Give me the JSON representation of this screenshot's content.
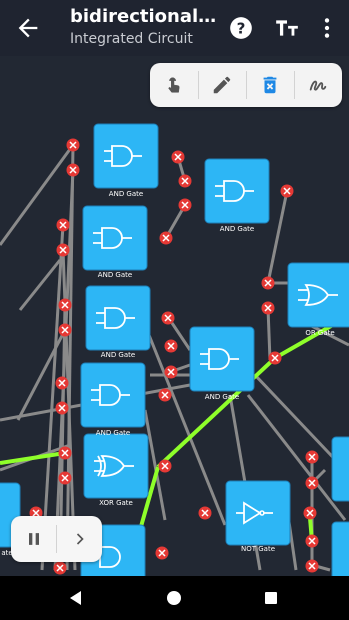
{
  "appbar": {
    "title": "bidirectional_c...",
    "subtitle": "Integrated Circuit",
    "icons": [
      "back-arrow-icon",
      "help-icon",
      "text-size-icon",
      "more-vert-icon"
    ]
  },
  "toolbar": {
    "tools": [
      "touch-icon",
      "pencil-icon",
      "delete-icon",
      "wire-icon"
    ]
  },
  "gates": [
    {
      "label": "AND Gate"
    },
    {
      "label": "AND Gate"
    },
    {
      "label": "AND Gate"
    },
    {
      "label": "AND Gate"
    },
    {
      "label": "OR Gate"
    },
    {
      "label": "AND Gate"
    },
    {
      "label": "AND Gate"
    },
    {
      "label": "XOR Gate"
    },
    {
      "label": "NOT Gate"
    },
    {
      "label": "ate"
    }
  ],
  "colors": {
    "gate_fill": "#2db6f5",
    "pin": "#e53935",
    "wire_off": "#8a8a8a",
    "wire_on": "#8fff2a",
    "background": "#222833"
  },
  "navbar": {
    "icons": [
      "back-triangle-icon",
      "home-circle-icon",
      "recents-square-icon"
    ]
  },
  "playback": {
    "icons": [
      "pause-icon",
      "step-forward-icon"
    ]
  }
}
